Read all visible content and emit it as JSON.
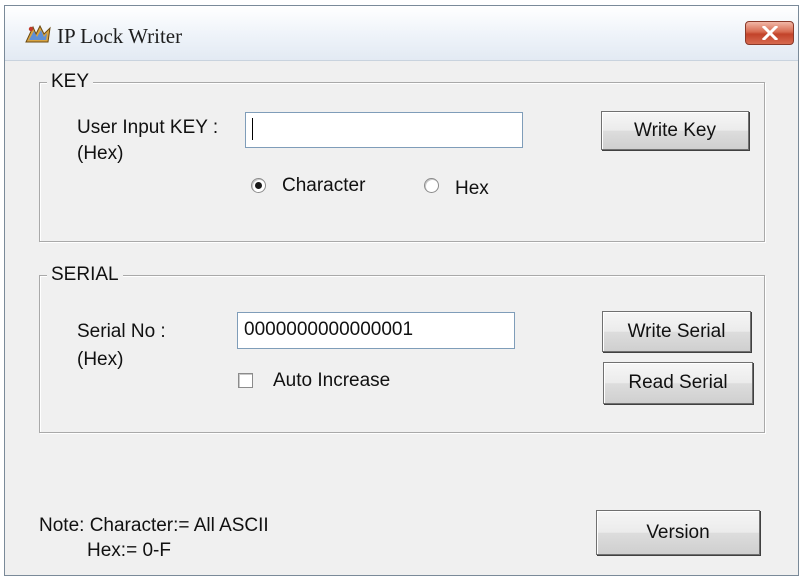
{
  "window": {
    "title": "IP Lock Writer",
    "icon": "lock-writer-app-icon",
    "close_icon": "close-icon"
  },
  "key_group": {
    "legend": "KEY",
    "input_label": "User Input KEY :",
    "input_sublabel": "(Hex)",
    "input_value": "",
    "write_key_label": "Write Key",
    "mode_options": [
      {
        "label": "Character",
        "selected": true
      },
      {
        "label": "Hex",
        "selected": false
      }
    ]
  },
  "serial_group": {
    "legend": "SERIAL",
    "serial_label": "Serial No :",
    "serial_sublabel": "(Hex)",
    "serial_value": "0000000000000001",
    "auto_increase_label": "Auto Increase",
    "auto_increase_checked": false,
    "write_serial_label": "Write Serial",
    "read_serial_label": "Read Serial"
  },
  "footer": {
    "note_line1": "Note: Character:= All ASCII",
    "note_line2": "Hex:= 0-F",
    "version_label": "Version"
  }
}
